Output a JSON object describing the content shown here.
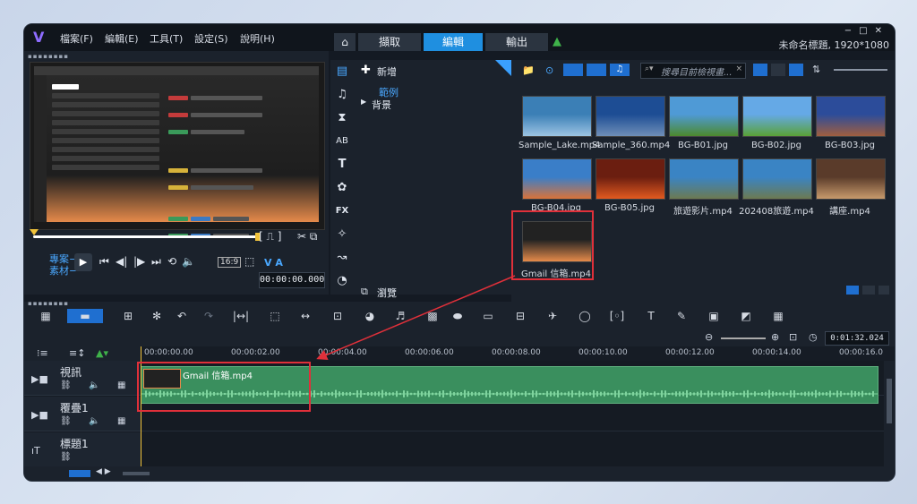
{
  "menu": [
    "檔案(F)",
    "編輯(E)",
    "工具(T)",
    "設定(S)",
    "說明(H)"
  ],
  "tabs": {
    "home_icon": "home-icon",
    "capture": "擷取",
    "edit": "編輯",
    "share": "輸出"
  },
  "title": "未命名標題, 1920*1080",
  "player": {
    "mode_project": "專案−",
    "mode_clip": "素材−",
    "aspect": "16:9",
    "timecode": "00:00:00.000"
  },
  "library": {
    "add_label": "新增",
    "tree": [
      "範例",
      "背景"
    ],
    "browse_label": "瀏覽",
    "search_placeholder": "搜尋目前檢視畫..."
  },
  "media": [
    {
      "name": "Sample_Lake.mp4",
      "color1": "#3b7fb6",
      "color2": "#9cc4e3"
    },
    {
      "name": "Sample_360.mp4",
      "color1": "#1d4d94",
      "color2": "#6f8fb8"
    },
    {
      "name": "BG-B01.jpg",
      "color1": "#4f9ad6",
      "color2": "#4c8a2c"
    },
    {
      "name": "BG-B02.jpg",
      "color1": "#65a9e6",
      "color2": "#5aa236"
    },
    {
      "name": "BG-B03.jpg",
      "color1": "#2c4c9a",
      "color2": "#a05e3f"
    },
    {
      "name": "BG-B04.jpg",
      "color1": "#3a7ec8",
      "color2": "#d9733a"
    },
    {
      "name": "BG-B05.jpg",
      "color1": "#6b1e10",
      "color2": "#e25a1f"
    },
    {
      "name": "旅遊影片.mp4",
      "color1": "#3a84c4",
      "color2": "#6c7a52"
    },
    {
      "name": "202408旅遊.mp4",
      "color1": "#3a84c4",
      "color2": "#6c7a52"
    },
    {
      "name": "講座.mp4",
      "color1": "#5a3b2a",
      "color2": "#c79a6c"
    },
    {
      "name": "Gmail 信箱.mp4",
      "color1": "#222222",
      "color2": "#e58a4a"
    }
  ],
  "timeline": {
    "zoom_time": "0:01:32.024",
    "ticks": [
      "00:00:00.00",
      "00:00:02.00",
      "00:00:04.00",
      "00:00:06.00",
      "00:00:08.00",
      "00:00:10.00",
      "00:00:12.00",
      "00:00:14.00",
      "00:00:16.0"
    ],
    "tracks": [
      "視訊",
      "覆疊1",
      "標題1"
    ],
    "clip_name": "Gmail 信箱.mp4"
  },
  "colors": {
    "accent": "#1f8fe0",
    "clip": "#3a8f5e",
    "highlight": "#e0303a"
  }
}
